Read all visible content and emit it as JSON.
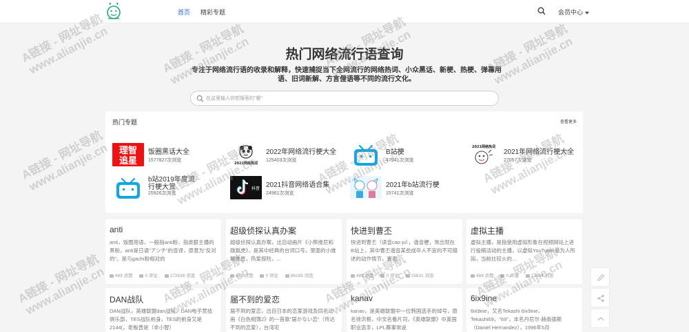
{
  "nav": {
    "links": [
      "首页",
      "精彩专题"
    ],
    "member": "会员中心"
  },
  "hero": {
    "title": "热门网络流行语查询",
    "desc": "专注于网络流行语的收录和解释，快速捕捉当下全网流行的网络热词、小众黑话、新梗、热梗、弹幕用语、旧词新解、方言俚语等不同的流行文化。",
    "search_placeholder": "在这里输入你想搜索的\"梗\""
  },
  "topics": {
    "title": "热门专题",
    "more": "查看更多",
    "items": [
      {
        "name": "饭圈黑话大全",
        "views": "1577827次浏览",
        "thumb_text": [
          "理智",
          "追星"
        ]
      },
      {
        "name": "2022年网络流行梗大全",
        "views": "125403次浏览",
        "thumb_text": [
          "2022网络热词"
        ]
      },
      {
        "name": "B站梗",
        "views": "47941次浏览",
        "thumb_text": []
      },
      {
        "name": "2021年网络流行梗大全",
        "views": "27057次浏览",
        "thumb_text": [
          "2021网络热词"
        ]
      },
      {
        "name": "b站2019年度流行梗大赏",
        "views": "25926次浏览",
        "thumb_text": []
      },
      {
        "name": "2021抖音网络语合集",
        "views": "24961次浏览",
        "thumb_text": [
          "抖音"
        ]
      },
      {
        "name": "2021年b站流行梗",
        "views": "15741次浏览",
        "thumb_text": []
      }
    ]
  },
  "cards": [
    {
      "title": "anti",
      "desc": "anti，饭圈用语，一般指anti粉，指虐狠主播的黑粉。anti是日语\"アンチ\"的音译，原意为\"反对的\"。是与gachi粉相对的",
      "likes": "489 点赞",
      "comments": "0 评论",
      "views": "172638 浏览"
    },
    {
      "title": "超级侦探认真办案",
      "desc": "超级侦探认真办案，出自动画片《小熊维尼和跳跳虎》，是其中经典的台词口号。里面的小维解推恩，热爱探险，...",
      "likes": "489 点赞",
      "comments": "0 评论",
      "views": "96189 浏览"
    },
    {
      "title": "快进到曹丕",
      "desc": "快进到曹丕（读音cao pi），谐音梗，常出现在B站上，其中曹丕谐音某些成年人不宜的不可描述的动作情节，置否...",
      "likes": "489 点赞",
      "comments": "0 评论",
      "views": "25631 浏览"
    },
    {
      "title": "虚拟主播",
      "desc": "虚拟主播，是指使用虚拟形象在视频网站上进行投稿活动的主播，以虚拟YouTuber最为人所知，当前比较火的...",
      "likes": "489 点赞",
      "comments": "0 评论",
      "views": "13504 浏览"
    },
    {
      "title": "DAN战队",
      "desc": "DAN战队，英雄联盟dan战队，DAN电子竞技俱乐部，TES战队前身，TES的前身又是2144(，老板曾是（非小智）",
      "likes": "",
      "comments": "",
      "views": ""
    },
    {
      "title": "届不到的爱恋",
      "desc": "届不到的爱恋，出自日本的恋爱游戏及同名动画《白色相簿2》的一首歌\"届かない恋\"（传达不到的恋爱），台湾宅",
      "likes": "",
      "comments": "",
      "views": ""
    },
    {
      "title": "kanav",
      "desc": "kanav，是英雄联盟中一位韩国选手的绰号，原名徐洪根，中文名看片司，《英雄联盟》中英国职业选手，LPL赛事常说",
      "likes": "",
      "comments": "",
      "views": ""
    },
    {
      "title": "6ix9ine",
      "desc": "6ix9ine，又名Tekashi 6ix9ine，Tekashi69，\"69\"，本名丹尼尔·赫南德斯（Daniel Hernandez），1996年5月",
      "likes": "",
      "comments": "",
      "views": ""
    }
  ],
  "watermark": {
    "line1": "A链接 - 网址导航",
    "line2": "www.alianjie.cn"
  }
}
